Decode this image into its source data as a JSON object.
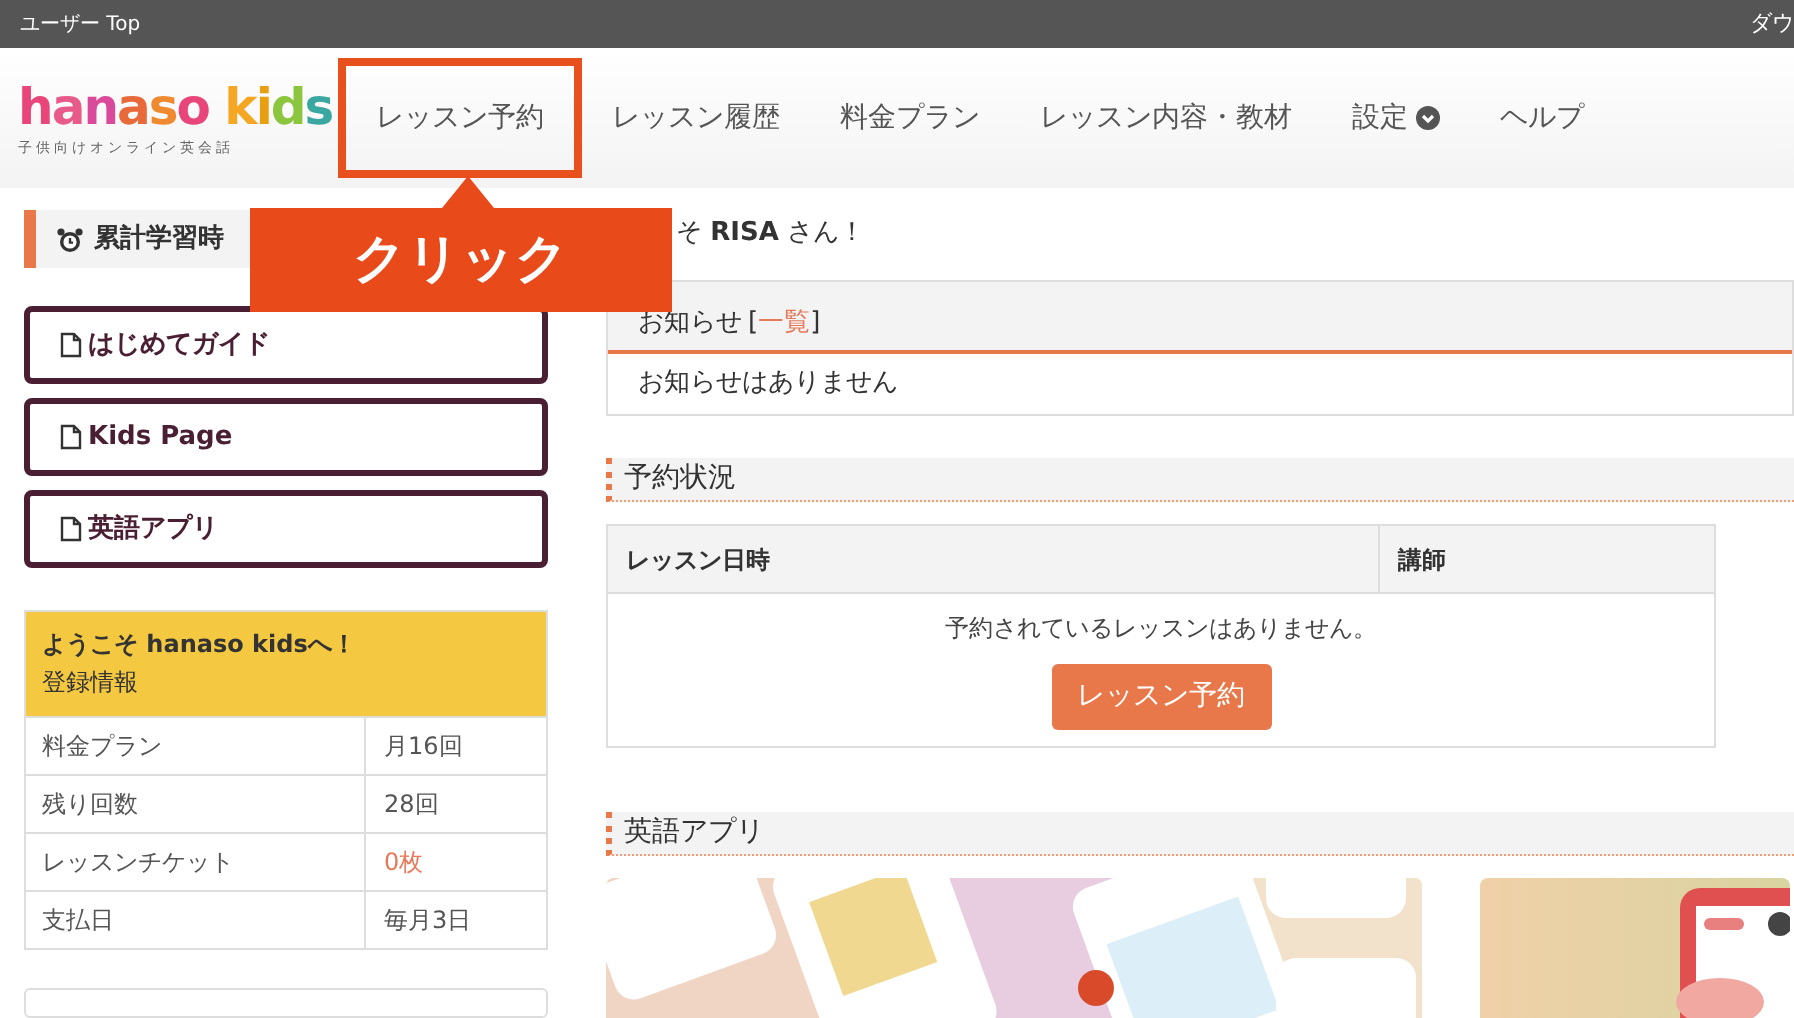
{
  "top_bar": {
    "title": "ユーザー Top",
    "right_text": "ダウ"
  },
  "logo": {
    "text": "hanaso kids",
    "tagline": "子供向けオンライン英会話"
  },
  "nav": [
    {
      "label": "レッスン予約",
      "highlighted": true,
      "dropdown": false
    },
    {
      "label": "レッスン履歴",
      "highlighted": false,
      "dropdown": false
    },
    {
      "label": "料金プラン",
      "highlighted": false,
      "dropdown": false
    },
    {
      "label": "レッスン内容・教材",
      "highlighted": false,
      "dropdown": false
    },
    {
      "label": "設定",
      "highlighted": false,
      "dropdown": true
    },
    {
      "label": "ヘルプ",
      "highlighted": false,
      "dropdown": false
    }
  ],
  "callout": {
    "text": "クリック"
  },
  "sidebar": {
    "study_time_heading": "累計学習時",
    "links": [
      {
        "label": "はじめてガイド"
      },
      {
        "label": "Kids Page"
      },
      {
        "label": "英語アプリ"
      }
    ],
    "info_card": {
      "title": "ようこそ hanaso kidsへ！",
      "subtitle": "登録情報",
      "rows": [
        {
          "label": "料金プラン",
          "value": "月16回",
          "alert": false
        },
        {
          "label": "残り回数",
          "value": "28回",
          "alert": false
        },
        {
          "label": "レッスンチケット",
          "value": "0枚",
          "alert": true
        },
        {
          "label": "支払日",
          "value": "毎月3日",
          "alert": false
        }
      ]
    }
  },
  "main": {
    "greeting": "そ **RISA** さん！",
    "notices": {
      "title": "お知らせ",
      "link_open": "[",
      "link": "一覧",
      "link_close": "]",
      "message": "お知らせはありません"
    },
    "reservations": {
      "heading": "予約状況",
      "columns": [
        "レッスン日時",
        "講師"
      ],
      "empty_message": "予約されているレッスンはありません。",
      "button": "レッスン予約"
    },
    "app": {
      "heading": "英語アプリ"
    }
  }
}
